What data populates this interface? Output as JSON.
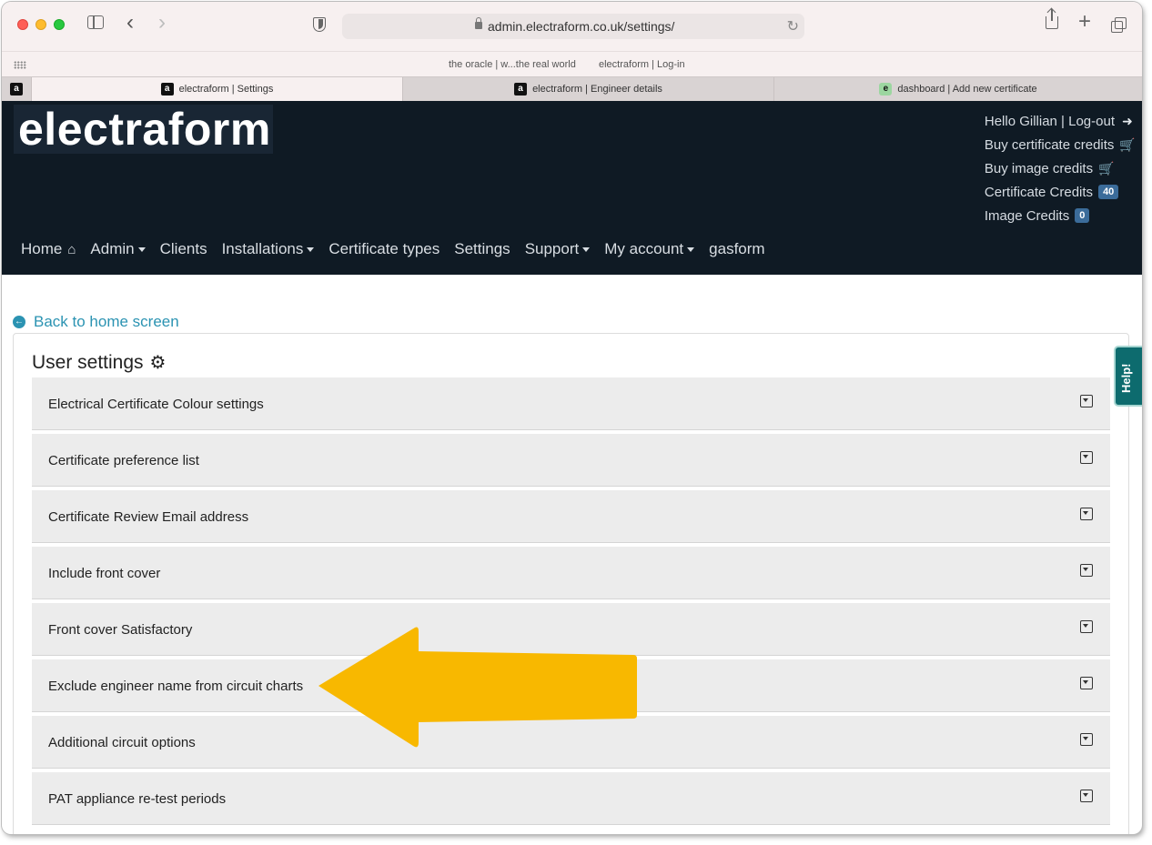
{
  "browser": {
    "url": "admin.electraform.co.uk/settings/",
    "favorites": [
      "the oracle | w...the real world",
      "electraform | Log-in"
    ],
    "tabs": [
      {
        "label": "electraform | Settings",
        "favicon": "a",
        "active": true
      },
      {
        "label": "electraform | Engineer details",
        "favicon": "a",
        "active": false
      },
      {
        "label": "dashboard | Add new certificate",
        "favicon": "e",
        "active": false
      }
    ],
    "pinned_tab_favicon": "a"
  },
  "header": {
    "logo": "electraform",
    "user_menu": {
      "greeting": "Hello Gillian | Log-out",
      "buy_certificate_credits": "Buy certificate credits",
      "buy_image_credits": "Buy image credits",
      "certificate_credits_label": "Certificate Credits",
      "certificate_credits_count": "40",
      "image_credits_label": "Image Credits",
      "image_credits_count": "0"
    },
    "nav": {
      "home": "Home",
      "admin": "Admin",
      "clients": "Clients",
      "installations": "Installations",
      "certificate_types": "Certificate types",
      "settings": "Settings",
      "support": "Support",
      "my_account": "My account",
      "gasform": "gasform"
    }
  },
  "content": {
    "back_link": "Back to home screen",
    "title": "User settings",
    "panels": [
      "Electrical Certificate Colour settings",
      "Certificate preference list",
      "Certificate Review Email address",
      "Include front cover",
      "Front cover Satisfactory",
      "Exclude engineer name from circuit charts",
      "Additional circuit options",
      "PAT appliance re-test periods"
    ]
  },
  "help_tab": "Help!",
  "colors": {
    "header_bg": "#0f1a24",
    "link": "#2b93b2",
    "panel_bg": "#ececec",
    "help_bg": "#0d6b6e",
    "badge": "#3b6c9a",
    "arrow": "#f8b800"
  },
  "icons": [
    "sidebar-icon",
    "back-arrow-icon",
    "forward-arrow-icon",
    "shield-icon",
    "lock-icon",
    "reload-icon",
    "share-icon",
    "new-tab-icon",
    "tab-overview-icon",
    "logout-icon",
    "cart-icon",
    "cart-plus-icon",
    "home-icon",
    "gear-icon",
    "arrow-circle-left-icon",
    "caret-square-down-icon"
  ]
}
